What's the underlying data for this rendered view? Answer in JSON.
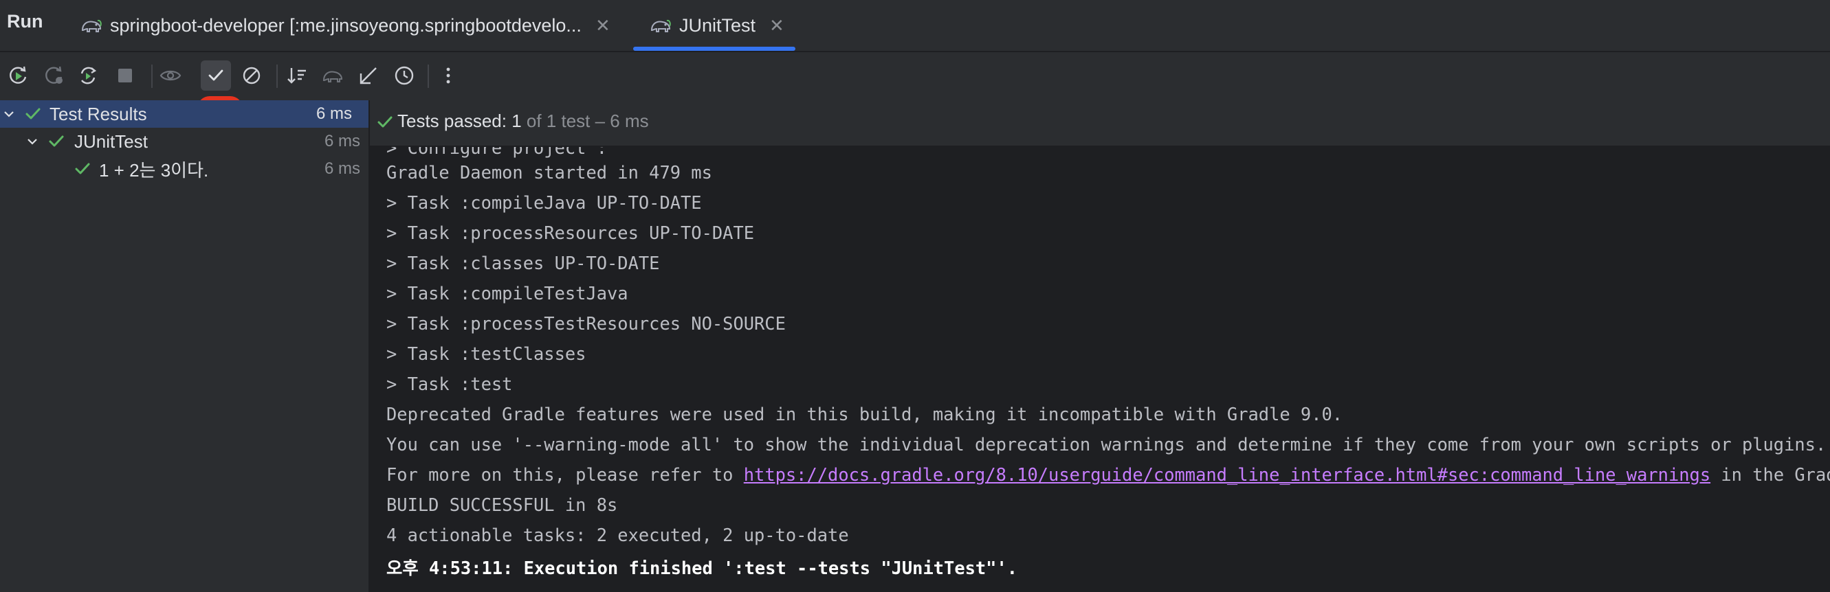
{
  "run_panel": {
    "title": "Run",
    "tabs": [
      {
        "label": "springboot-developer [:me.jinsoyeong.springbootdevelo...",
        "icon": "gradle-elephant-icon"
      },
      {
        "label": "JUnitTest",
        "icon": "gradle-elephant-icon",
        "active": true
      }
    ]
  },
  "toolbar": {
    "buttons": [
      "rerun-icon",
      "rerun-failed-icon",
      "toggle-auto-test-icon",
      "stop-icon",
      "show-ignored-icon",
      "show-passed-icon",
      "show-ignored-toggle-icon",
      "sort-icon",
      "import-tests-icon",
      "export-icon",
      "history-icon",
      "more-icon"
    ],
    "pressed": "show-passed-icon",
    "highlight_color": "#e5331f"
  },
  "tree": {
    "rows": [
      {
        "label": "Test Results",
        "time": "6 ms",
        "selected": true
      },
      {
        "label": "JUnitTest",
        "time": "6 ms"
      },
      {
        "label": "1 + 2는 3이다.",
        "time": "6 ms"
      }
    ]
  },
  "status": {
    "prefix": "Tests passed: ",
    "passed": "1",
    "suffix": " of 1 test – 6 ms"
  },
  "console": {
    "cut_line": "> Configure project :",
    "lines": [
      "Gradle Daemon started in 479 ms",
      "> Task :compileJava UP-TO-DATE",
      "> Task :processResources UP-TO-DATE",
      "> Task :classes UP-TO-DATE",
      "> Task :compileTestJava",
      "> Task :processTestResources NO-SOURCE",
      "> Task :testClasses",
      "> Task :test",
      "Deprecated Gradle features were used in this build, making it incompatible with Gradle 9.0.",
      "You can use '--warning-mode all' to show the individual deprecation warnings and determine if they come from your own scripts or plugins."
    ],
    "refer_prefix": "For more on this, please refer to ",
    "refer_link": "https://docs.gradle.org/8.10/userguide/command_line_interface.html#sec:command_line_warnings",
    "refer_suffix": " in the Gradle documentation.",
    "after_lines": [
      "BUILD SUCCESSFUL in 8s",
      "4 actionable tasks: 2 executed, 2 up-to-date"
    ],
    "final_line": "오후 4:53:11: Execution finished ':test --tests \"JUnitTest\"'."
  },
  "colors": {
    "check_green": "#5fb865",
    "selection": "#2e436e",
    "link": "#c77dff",
    "accent": "#3574f0"
  }
}
